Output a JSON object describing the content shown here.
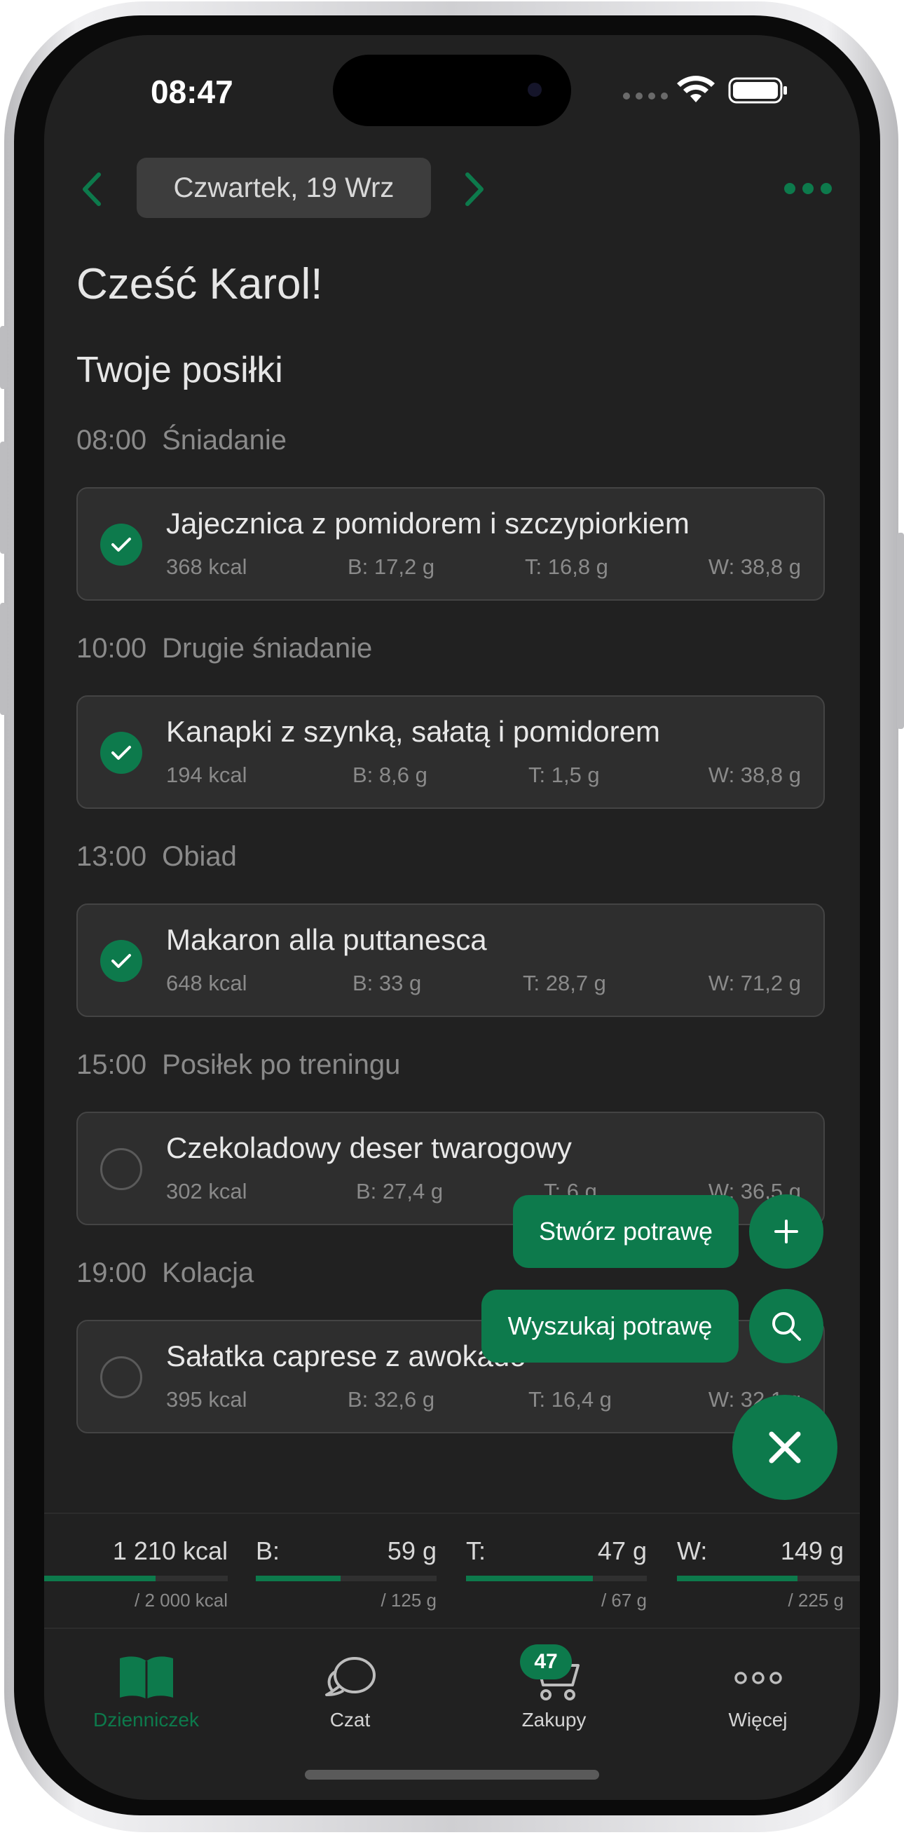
{
  "status_bar": {
    "time": "08:47"
  },
  "header": {
    "date": "Czwartek, 19 Wrz"
  },
  "greeting": "Cześć Karol!",
  "section_title": "Twoje posiłki",
  "meals": [
    {
      "time": "08:00",
      "label": "Śniadanie",
      "name": "Jajecznica z pomidorem i szczypiorkiem",
      "kcal": "368 kcal",
      "b": "B: 17,2 g",
      "t": "T: 16,8 g",
      "w": "W: 38,8 g",
      "eaten": true
    },
    {
      "time": "10:00",
      "label": "Drugie śniadanie",
      "name": "Kanapki z szynką, sałatą i pomidorem",
      "kcal": "194 kcal",
      "b": "B: 8,6 g",
      "t": "T: 1,5 g",
      "w": "W: 38,8 g",
      "eaten": true
    },
    {
      "time": "13:00",
      "label": "Obiad",
      "name": "Makaron alla puttanesca",
      "kcal": "648 kcal",
      "b": "B: 33 g",
      "t": "T: 28,7 g",
      "w": "W: 71,2 g",
      "eaten": true
    },
    {
      "time": "15:00",
      "label": "Posiłek po treningu",
      "name": "Czekoladowy deser twarogowy",
      "kcal": "302 kcal",
      "b": "B: 27,4 g",
      "t": "T: 6 g",
      "w": "W: 36,5 g",
      "eaten": false
    },
    {
      "time": "19:00",
      "label": "Kolacja",
      "name": "Sałatka caprese z awokado",
      "kcal": "395 kcal",
      "b": "B: 32,6 g",
      "t": "T: 16,4 g",
      "w": "W: 32,1 g",
      "eaten": false
    }
  ],
  "fab": {
    "create_label": "Stwórz potrawę",
    "search_label": "Wyszukaj potrawę"
  },
  "summary": {
    "kcal": {
      "label": "",
      "value": "1 210 kcal",
      "target": "/ 2 000 kcal",
      "progress": 0.605
    },
    "protein": {
      "label": "B:",
      "value": "59 g",
      "target": "/ 125 g",
      "progress": 0.47
    },
    "fat": {
      "label": "T:",
      "value": "47 g",
      "target": "/ 67 g",
      "progress": 0.7
    },
    "carbs": {
      "label": "W:",
      "value": "149 g",
      "target": "/ 225 g",
      "progress": 0.66
    }
  },
  "tabs": {
    "diary": "Dzienniczek",
    "chat": "Czat",
    "shopping": "Zakupy",
    "shopping_badge": "47",
    "more": "Więcej"
  },
  "colors": {
    "accent": "#0d7a4c",
    "background": "#212121",
    "card": "#2e2e2e"
  }
}
